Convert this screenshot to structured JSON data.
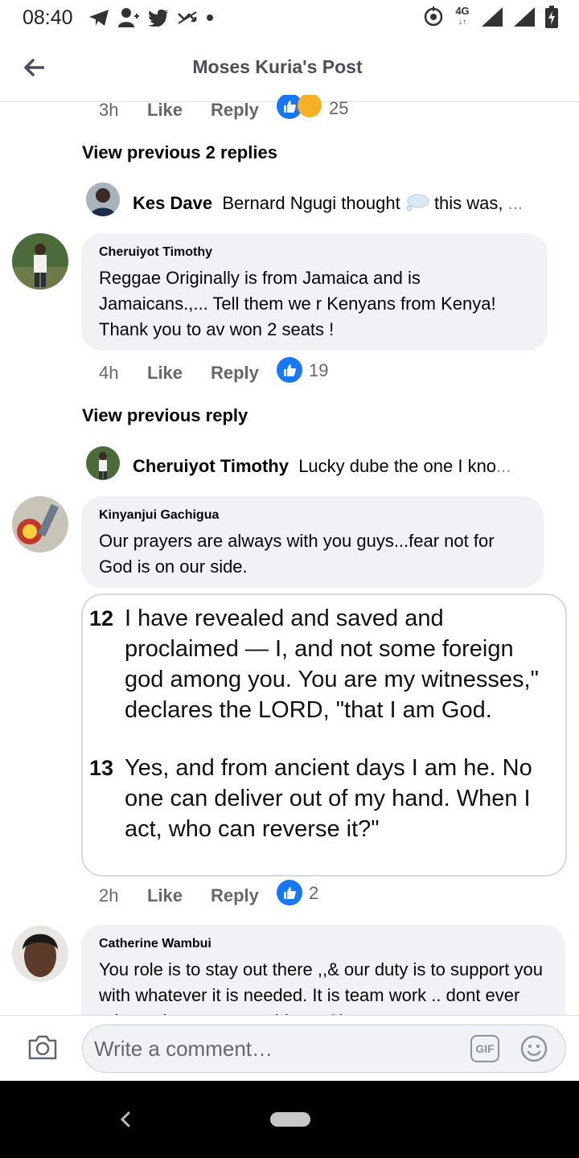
{
  "status_bar": {
    "time": "08:40",
    "network": "4G"
  },
  "header": {
    "title": "Moses Kuria's Post"
  },
  "comments": {
    "top": {
      "time": "3h",
      "like": "Like",
      "reply": "Reply",
      "reactions": "25"
    },
    "view_prev_1": "View previous 2 replies",
    "reply_1": {
      "name": "Kes Dave",
      "text": "Bernard Ngugi thought",
      "text2": "this was,",
      "ellipsis": "..."
    },
    "c1": {
      "author": "Cheruiyot Timothy",
      "text": "Reggae Originally is from Jamaica and is Jamaicans.,... Tell them we r Kenyans from Kenya! Thank you to av won 2 seats !",
      "time": "4h",
      "like": "Like",
      "reply": "Reply",
      "reactions": "19"
    },
    "view_prev_2": "View previous reply",
    "reply_2": {
      "name": "Cheruiyot Timothy",
      "text": "Lucky dube  the one I kno",
      "ellipsis": "..."
    },
    "c2": {
      "author": "Kinyanjui Gachigua",
      "text": "Our prayers are always with you guys...fear not for God is on our side.",
      "verse12_num": "12",
      "verse12": "I have revealed and saved and proclaimed — I, and not some foreign god among you. You are my witnesses,\" declares the LORD, \"that I am God.",
      "verse13_num": "13",
      "verse13": "Yes, and from ancient days I am he. No one can deliver out of my hand. When I act, who can reverse it?\"",
      "time": "2h",
      "like": "Like",
      "reply": "Reply",
      "reactions": "2"
    },
    "c3": {
      "author": "Catherine Wambui",
      "text": "You role is to stay out there ,,& our duty is to support you with whatever it is needed. It is team work .. dont ever relent, always go to achieve. Sir"
    }
  },
  "composer": {
    "placeholder": "Write a comment…",
    "gif_label": "GIF"
  },
  "colors": {
    "accent": "#1877f2",
    "bubble": "#f0f2f5",
    "meta": "#65676b"
  },
  "icons": [
    "telegram-icon",
    "add-user-icon",
    "twitter-icon",
    "missed-call-icon",
    "dot-icon",
    "sync-icon",
    "signal-icon",
    "battery-icon",
    "back-arrow-icon",
    "like-icon",
    "haha-icon",
    "thought-bubble-icon",
    "camera-icon",
    "gif-icon",
    "emoji-icon",
    "nav-back-icon",
    "home-pill-icon"
  ]
}
